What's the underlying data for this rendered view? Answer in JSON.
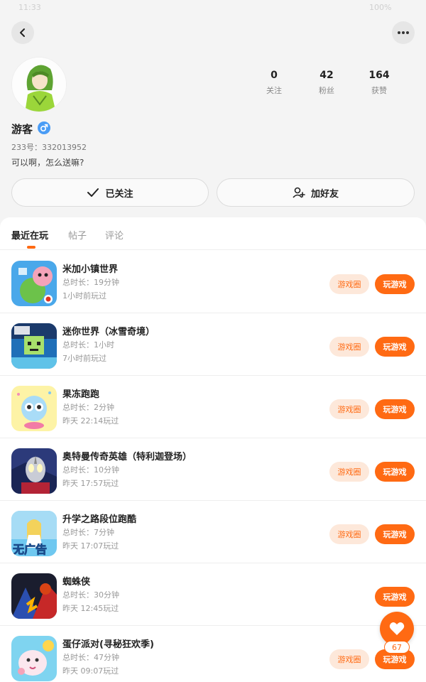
{
  "colors": {
    "accent": "#ff6a13",
    "accent_light": "#fde8da",
    "gender_male": "#4a9cf5"
  },
  "status_bar": {
    "time": "11:33",
    "battery": "100%"
  },
  "profile": {
    "name": "游客",
    "uid_label": "233号：",
    "uid": "332013952",
    "bio": "可以啊，怎么送嘛?",
    "gender_icon": "male-icon"
  },
  "stats": [
    {
      "value": "0",
      "label": "关注"
    },
    {
      "value": "42",
      "label": "粉丝"
    },
    {
      "value": "164",
      "label": "获赞"
    }
  ],
  "actions": {
    "follow_label": "已关注",
    "add_friend_label": "加好友"
  },
  "tabs": [
    {
      "label": "最近在玩",
      "active": true
    },
    {
      "label": "帖子",
      "active": false
    },
    {
      "label": "评论",
      "active": false
    }
  ],
  "buttons": {
    "circle": "游戏圈",
    "play": "玩游戏"
  },
  "games": [
    {
      "name": "米加小镇世界",
      "duration": "总时长：19分钟",
      "last_played": "1小时前玩过",
      "has_circle": true,
      "icon": "miga-town-icon"
    },
    {
      "name": "迷你世界（冰雪奇境）",
      "duration": "总时长：1小时",
      "last_played": "7小时前玩过",
      "has_circle": true,
      "icon": "mini-world-icon"
    },
    {
      "name": "果冻跑跑",
      "duration": "总时长：2分钟",
      "last_played": "昨天 22:14玩过",
      "has_circle": true,
      "icon": "jelly-run-icon"
    },
    {
      "name": "奥特曼传奇英雄（特利迦登场）",
      "duration": "总时长：10分钟",
      "last_played": "昨天 17:57玩过",
      "has_circle": true,
      "icon": "ultraman-icon"
    },
    {
      "name": "升学之路段位跑酷",
      "duration": "总时长：7分钟",
      "last_played": "昨天 17:07玩过",
      "has_circle": true,
      "icon": "school-run-icon",
      "icon_text": "无广告"
    },
    {
      "name": "蜘蛛侠",
      "duration": "总时长：30分钟",
      "last_played": "昨天 12:45玩过",
      "has_circle": false,
      "icon": "spiderman-icon"
    },
    {
      "name": "蛋仔派对(寻秘狂欢季)",
      "duration": "总时长：47分钟",
      "last_played": "昨天 09:07玩过",
      "has_circle": true,
      "icon": "eggy-party-icon"
    }
  ],
  "fab": {
    "count": "67",
    "icon": "heart-icon"
  }
}
